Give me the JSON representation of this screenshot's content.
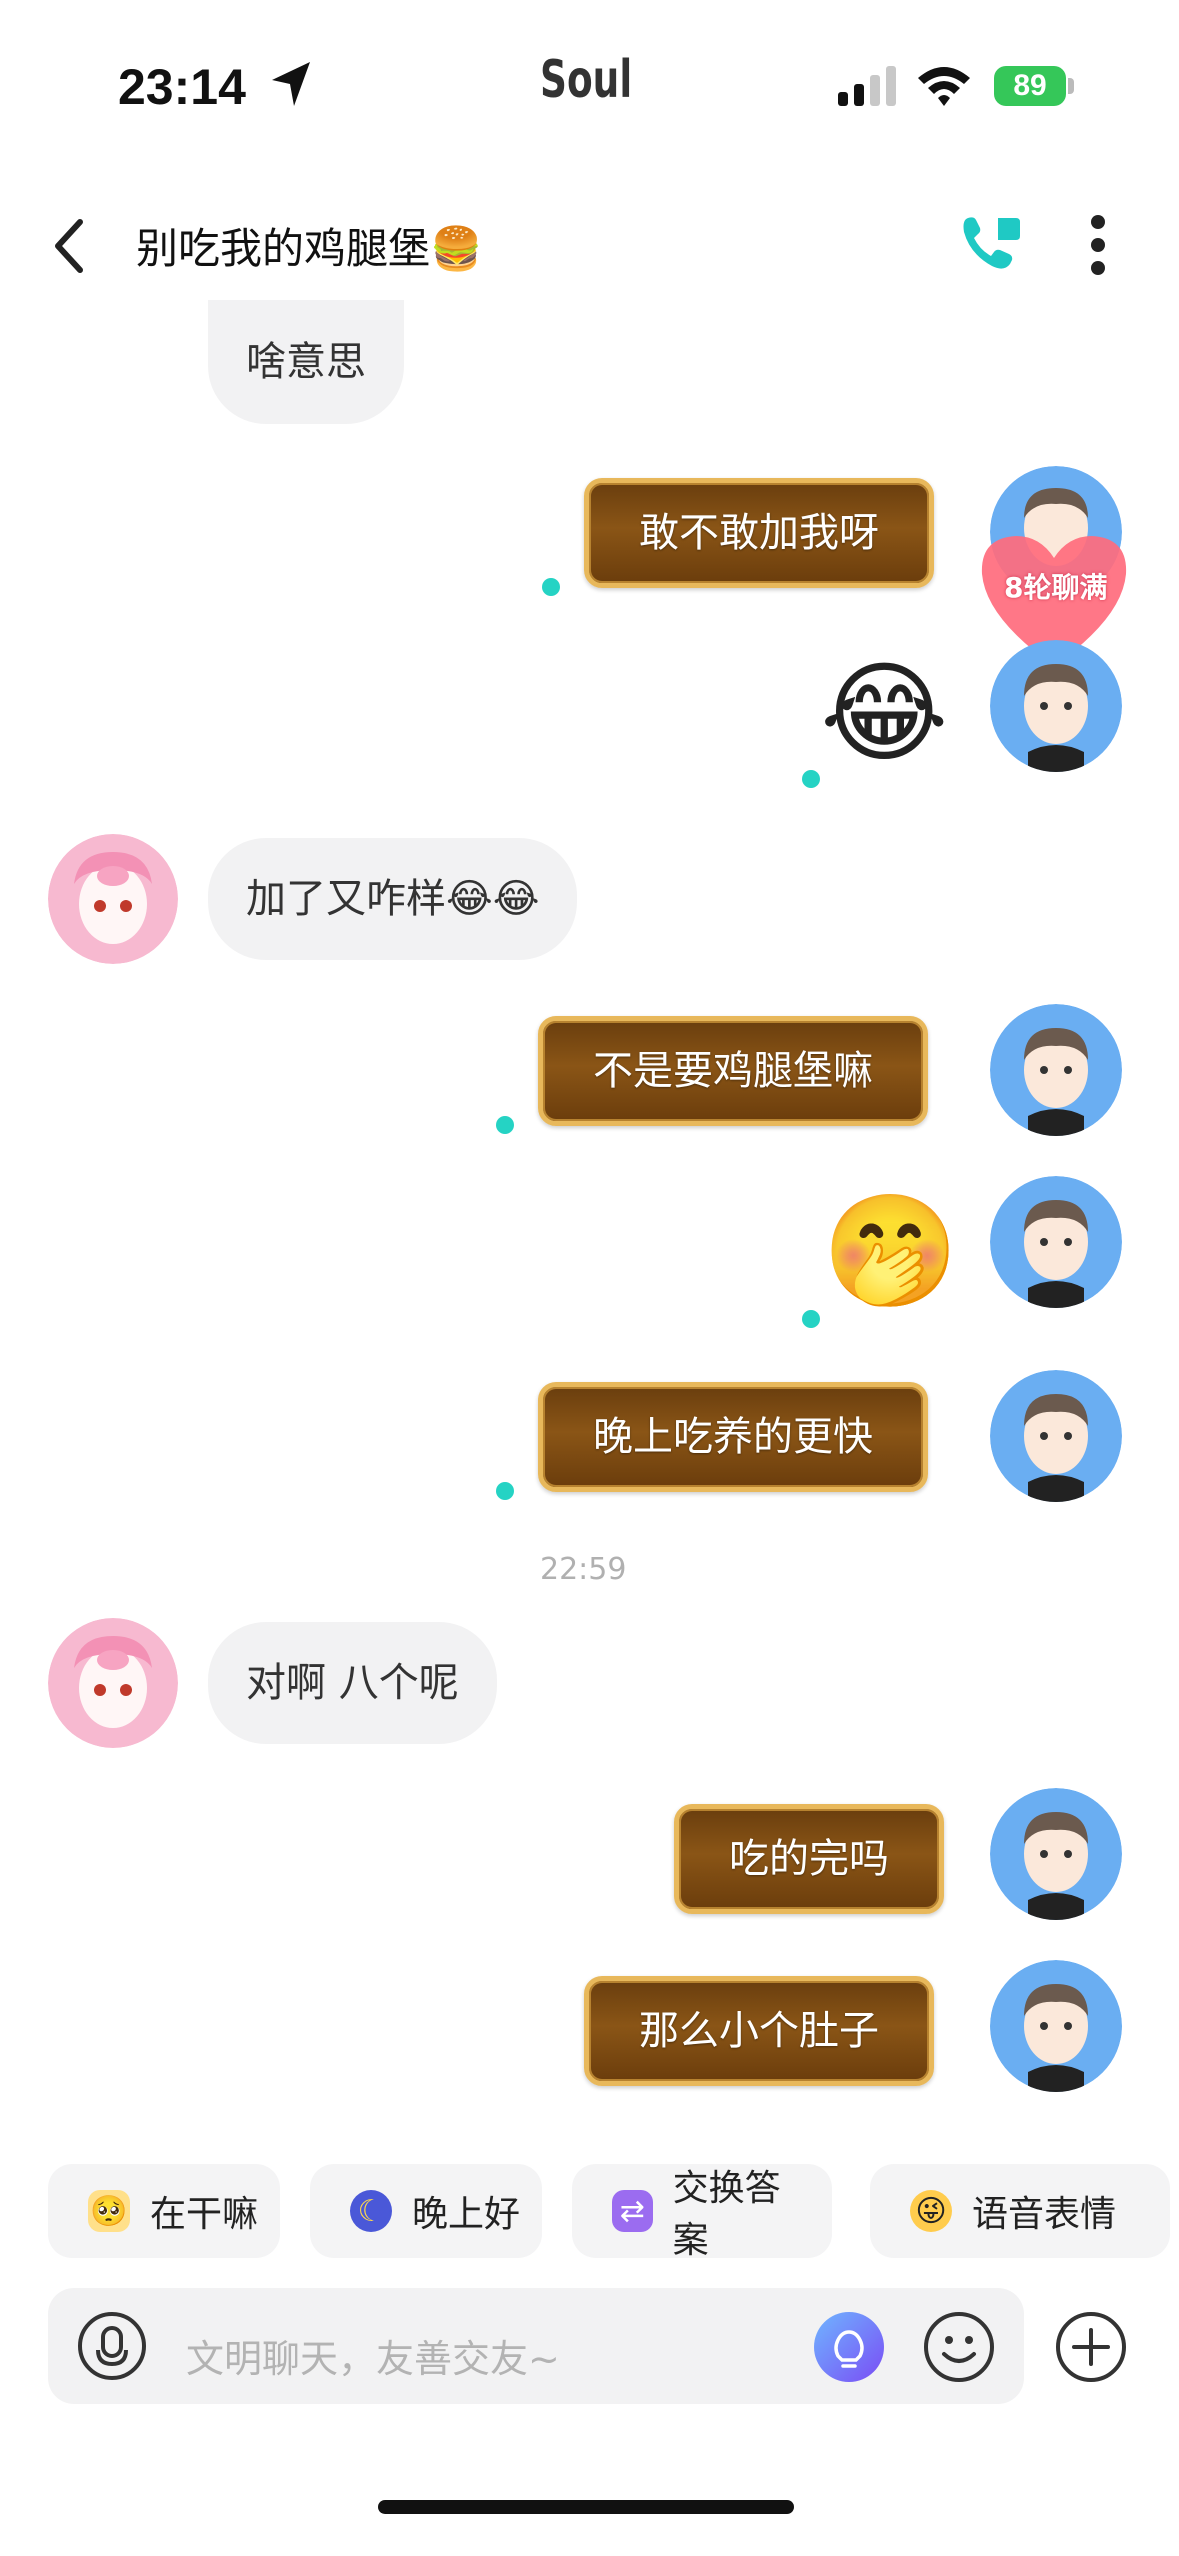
{
  "status_bar": {
    "time": "23:14",
    "carrier": "Soul",
    "battery": "89"
  },
  "header": {
    "title": "别吃我的鸡腿堡🍔"
  },
  "messages": [
    {
      "text": "啥意思"
    },
    {
      "text": "敢不敢加我呀"
    },
    {
      "text": "😂"
    },
    {
      "text": "加了又咋样😂😂"
    },
    {
      "text": "不是要鸡腿堡嘛"
    },
    {
      "text": "🤭"
    },
    {
      "text": "晚上吃养的更快"
    },
    {
      "text": "对啊 八个呢"
    },
    {
      "text": "吃的完吗"
    },
    {
      "text": "那么小个肚子"
    }
  ],
  "timestamp": "22:59",
  "badge": {
    "text": "8轮聊满"
  },
  "quick_replies": [
    "在干嘛",
    "晚上好",
    "交换答案",
    "语音表情"
  ],
  "input": {
    "placeholder": "文明聊天，友善交友~"
  },
  "colors": {
    "accent": "#25d3c4",
    "bubble_gold": "#8a5516",
    "bubble_in": "#f2f2f3"
  }
}
